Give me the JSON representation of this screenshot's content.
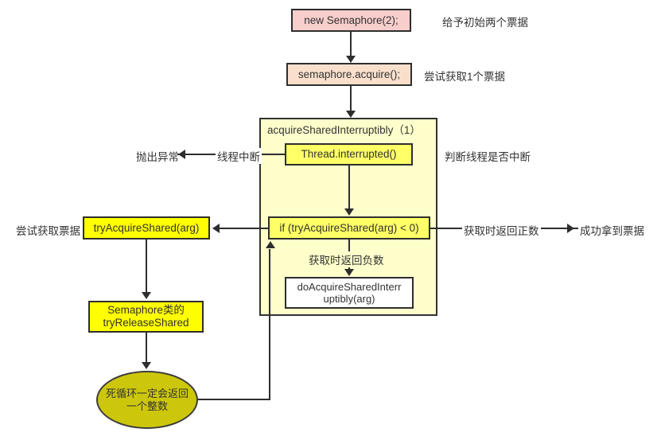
{
  "diagram": {
    "title": "Semaphore acquireSharedInterruptibly flow",
    "colors": {
      "pink_fill": "#f8cecc",
      "peach_fill": "#fae0cc",
      "pale_yellow_fill": "#ffffcc",
      "light_yellow_fill": "#ffff66",
      "bright_yellow_fill": "#ffff00",
      "olive_fill": "#cdc70c",
      "white_fill": "#ffffff",
      "stroke": "#2e2e2e",
      "text": "#333333"
    },
    "nodes": {
      "new_semaphore": "new Semaphore(2);",
      "acquire_call": "semaphore.acquire();",
      "container_title": "acquireSharedInterruptibly（1）",
      "thread_interrupted": "Thread.interrupted()",
      "if_check": "if (tryAcquireShared(arg) < 0)",
      "do_acquire": "doAcquireSharedInterr\nuptibly(arg)",
      "try_acquire_shared": "tryAcquireShared(arg)",
      "semaphore_release": "Semaphore类的\ntryReleaseShared",
      "infinite_loop": "死循环一定会返回\n一个整数"
    },
    "labels": {
      "init_two_tickets": "给予初始两个票据",
      "try_get_one_ticket": "尝试获取1个票据",
      "judge_interrupt": "判断线程是否中断",
      "throw_exception": "抛出异常",
      "thread_interrupt": "线程中断",
      "try_get_ticket": "尝试获取票据",
      "return_positive": "获取时返回正数",
      "got_ticket": "成功拿到票据",
      "return_negative": "获取时返回负数"
    }
  }
}
